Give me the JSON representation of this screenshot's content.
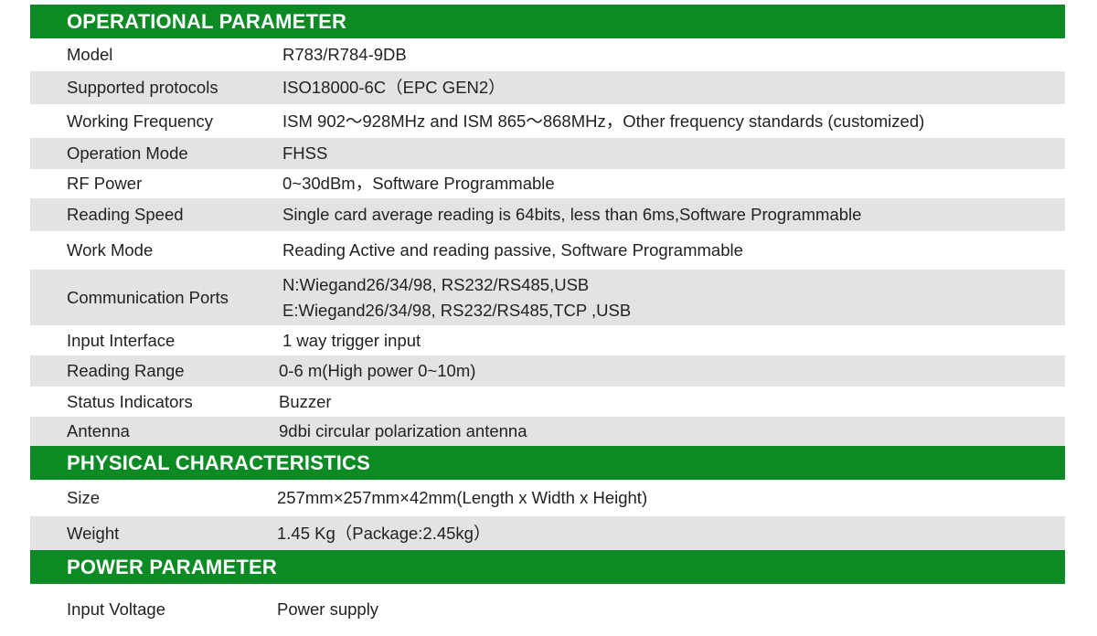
{
  "sections": [
    {
      "title": "OPERATIONAL PARAMETER",
      "rows": [
        {
          "label": "Model",
          "value": [
            "R783/R784-9DB"
          ]
        },
        {
          "label": "Supported protocols",
          "value": [
            "ISO18000-6C（EPC GEN2）"
          ]
        },
        {
          "label": "Working Frequency",
          "value": [
            "ISM 902～928MHz and ISM 865～868MHz，Other frequency standards (customized)"
          ]
        },
        {
          "label": "Operation Mode",
          "value": [
            "FHSS"
          ]
        },
        {
          "label": "RF Power",
          "value": [
            "0~30dBm，Software Programmable"
          ]
        },
        {
          "label": "Reading Speed",
          "value": [
            "Single card average reading is 64bits, less than 6ms,Software Programmable"
          ]
        },
        {
          "label": "Work Mode",
          "value": [
            "Reading Active and reading passive, Software Programmable"
          ]
        },
        {
          "label": "Communication Ports",
          "value": [
            "N:Wiegand26/34/98, RS232/RS485,USB",
            "E:Wiegand26/34/98, RS232/RS485,TCP ,USB"
          ]
        },
        {
          "label": "Input Interface",
          "value": [
            "1 way trigger input"
          ]
        },
        {
          "label": "Reading Range",
          "value": [
            "0-6 m(High power 0~10m)"
          ]
        },
        {
          "label": "Status Indicators",
          "value": [
            "Buzzer"
          ]
        },
        {
          "label": "Antenna",
          "value": [
            "9dbi circular polarization antenna"
          ]
        }
      ]
    },
    {
      "title": "PHYSICAL CHARACTERISTICS",
      "rows": [
        {
          "label": "Size",
          "value": [
            "257mm×257mm×42mm(Length x Width x Height)"
          ]
        },
        {
          "label": "Weight",
          "value": [
            "1.45 Kg（Package:2.45kg）"
          ]
        }
      ]
    },
    {
      "title": "POWER PARAMETER",
      "rows": [
        {
          "label": "Input Voltage",
          "value": [
            "Power supply"
          ]
        }
      ]
    }
  ],
  "colors": {
    "header_green": "#0c8a24",
    "row_shade": "#e3e3e3"
  }
}
